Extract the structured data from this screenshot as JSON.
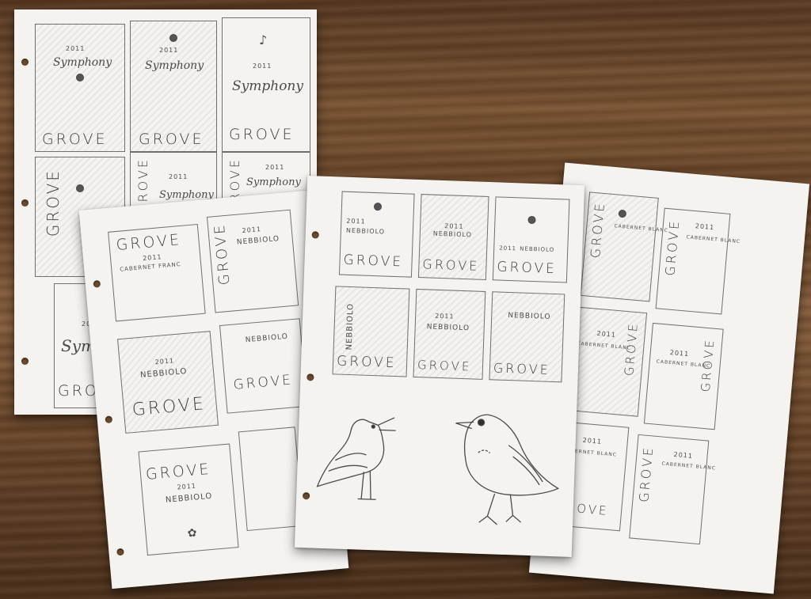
{
  "scene": {
    "colors": {
      "wood_dark": "#5a3c24",
      "wood_light": "#8a6240",
      "paper": "#f4f3ef",
      "pencil": "#4a4a4a"
    }
  },
  "sketches": {
    "brand": "GROVE",
    "year": "2011",
    "symphony": "Symphony",
    "nebbiolo": "NEBBIOLO",
    "cabernet": "CABERNET FRANC",
    "cabernet_blanc": "CABERNET BLANC"
  }
}
